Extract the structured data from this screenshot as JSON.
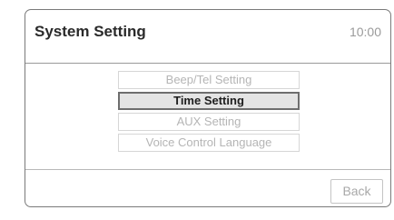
{
  "screen": {
    "title": "System Setting",
    "clock": "10:00"
  },
  "menu": {
    "items": [
      {
        "label": "Beep/Tel Setting",
        "selected": false
      },
      {
        "label": "Time Setting",
        "selected": true
      },
      {
        "label": "AUX Setting",
        "selected": false
      },
      {
        "label": "Voice Control Language",
        "selected": false
      }
    ]
  },
  "footer": {
    "back_label": "Back"
  }
}
